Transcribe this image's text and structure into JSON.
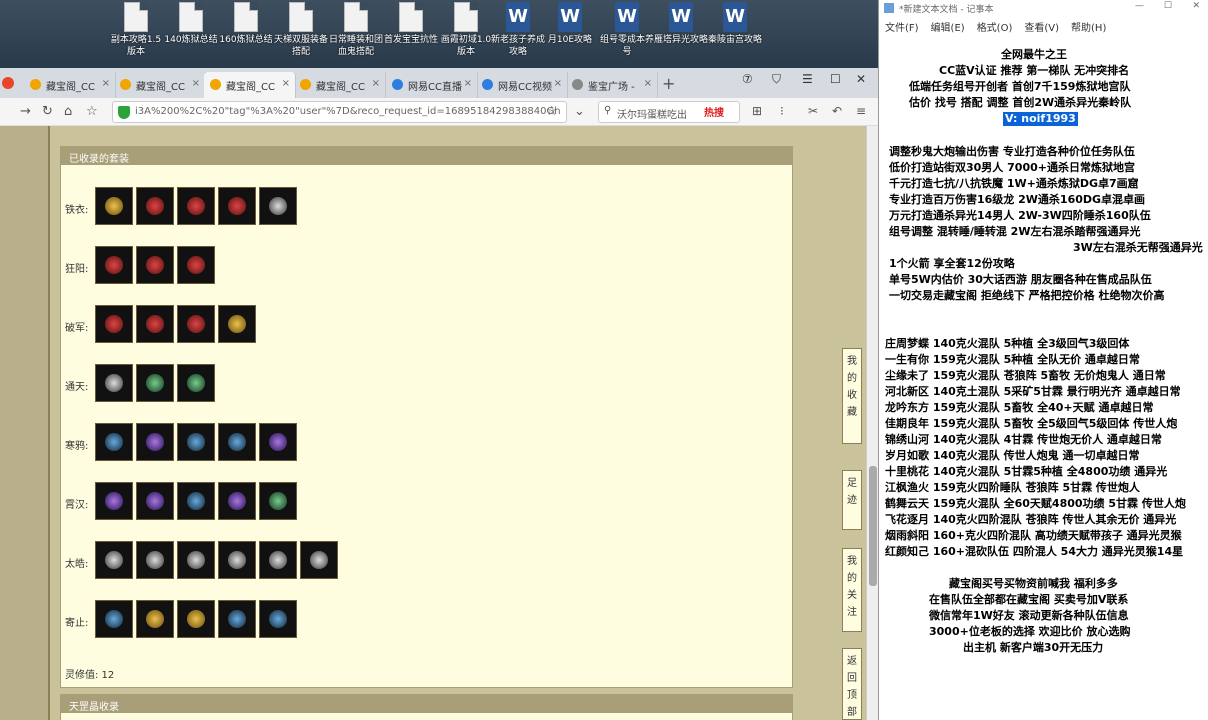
{
  "desktop": {
    "icons": [
      {
        "label": "副本攻略1.5版本",
        "type": "file"
      },
      {
        "label": "140炼狱总结",
        "type": "file"
      },
      {
        "label": "160炼狱总结",
        "type": "file"
      },
      {
        "label": "天梯双服装备搭配",
        "type": "file"
      },
      {
        "label": "日常睡装和团血鬼搭配",
        "type": "file"
      },
      {
        "label": "首发宝宝抗性",
        "type": "file"
      },
      {
        "label": "画霞初域1.0版本",
        "type": "file"
      },
      {
        "label": "新老孩子养成攻略",
        "type": "word"
      },
      {
        "label": "月10E攻略",
        "type": "word"
      },
      {
        "label": "组号零成本养号",
        "type": "word"
      },
      {
        "label": "雁塔异光攻略",
        "type": "word"
      },
      {
        "label": "秦陵宙宫攻略",
        "type": "word"
      }
    ]
  },
  "browser": {
    "tabs": [
      {
        "label": "藏宝阁_CC",
        "active": false
      },
      {
        "label": "藏宝阁_CC",
        "active": false
      },
      {
        "label": "藏宝阁_CC",
        "active": true
      },
      {
        "label": "藏宝阁_CC",
        "active": false
      },
      {
        "label": "网易CC直播",
        "active": false
      },
      {
        "label": "网易CC视频",
        "active": false
      },
      {
        "label": "鉴宝广场 -",
        "active": false
      }
    ],
    "url": "i3A%200%2C%20\"tag\"%3A%20\"user\"%7D&reco_request_id=1689518429838840Gh",
    "search_text": "沃尔玛蛋糕吃出",
    "hot_label": "热搜"
  },
  "page": {
    "section_title": "已收录的套装",
    "rows": [
      {
        "label": "铁衣:",
        "items": [
          "c-gold",
          "c-red",
          "c-red",
          "c-red",
          "c-silver"
        ]
      },
      {
        "label": "狂阳:",
        "items": [
          "c-red",
          "c-red",
          "c-red"
        ]
      },
      {
        "label": "破军:",
        "items": [
          "c-red",
          "c-red",
          "c-red",
          "c-gold"
        ]
      },
      {
        "label": "通天:",
        "items": [
          "c-silver",
          "c-green",
          "c-green"
        ]
      },
      {
        "label": "寒鸦:",
        "items": [
          "c-blue",
          "c-purple",
          "c-blue",
          "c-blue",
          "c-purple"
        ]
      },
      {
        "label": "霄汉:",
        "items": [
          "c-purple",
          "c-purple",
          "c-blue",
          "c-purple",
          "c-green"
        ]
      },
      {
        "label": "太皓:",
        "items": [
          "c-silver",
          "c-silver",
          "c-silver",
          "c-silver",
          "c-silver",
          "c-silver"
        ]
      },
      {
        "label": "寄止:",
        "items": [
          "c-blue",
          "c-gold",
          "c-gold",
          "c-blue",
          "c-blue"
        ]
      }
    ],
    "stat_text": "灵修值:  12",
    "next_section_title": "天罡晶收录",
    "side_nav": [
      "我的收藏",
      "足迹",
      "我的关注",
      "返回顶部"
    ]
  },
  "notepad": {
    "title": "*新建文本文档 - 记事本",
    "menu": [
      "文件(F)",
      "编辑(E)",
      "格式(O)",
      "查看(V)",
      "帮助(H)"
    ],
    "lines": [
      "全网最牛之王",
      "CC蓝V认证 推荐 第一梯队 无冲突排名",
      "低端任务组号开创者          首创7千159炼狱地宫队",
      "估价 找号 搭配 调整         首创2W通杀异光秦岭队",
      "V:  noif1993",
      "调整秒鬼大炮输出伤害          专业打造各种价位任务队伍",
      "低价打造站街双30男人           7000+通杀日常炼狱地宫",
      "千元打造七抗/八抗铁魔            1W+通杀炼狱DG卓7画窟",
      "专业打造百万伤害16级龙          2W通杀160DG卓混卓画",
      "万元打造通杀异光14男人          2W-3W四阶睡杀160队伍",
      "组号调整 混转睡/睡转混             2W左右混杀踏帮强通异光",
      "3W左右混杀无帮强通异光",
      "1个火箭 享全套12份攻略",
      "单号5W内估价 30大话西游         朋友圈各种在售成品队伍",
      "一切交易走藏宝阁 拒绝线下      严格把控价格 杜绝物次价高",
      "庄周梦蝶 140克火混队 5种植 全3级回气3级回体",
      "一生有你 159克火混队 5种植 全队无价 通卓越日常",
      "尘缘未了 159克火混队 苍狼阵 5畜牧 无价炮鬼人 通日常",
      "河北新区 140克土混队 5采矿5甘霖 景行明光齐 通卓越日常",
      "龙吟东方 159克火混队 5畜牧 全40+天赋 通卓越日常",
      "佳期良年 159克火混队 5畜牧 全5级回气5级回体 传世人炮",
      "锦绣山河 140克火混队 4甘霖 传世炮无价人 通卓越日常",
      "岁月如歌 140克火混队 传世人炮鬼 通一切卓越日常",
      "十里桃花 140克火混队 5甘霖5种植 全4800功绩 通异光",
      "江枫渔火 159克火四阶睡队 苍狼阵 5甘霖 传世炮人",
      "鹤舞云天 159克火混队 全60天赋4800功绩 5甘霖 传世人炮",
      "飞花逐月 140克火四阶混队 苍狼阵 传世人其余无价 通异光",
      "烟雨斜阳 160+克火四阶混队 高功绩天赋带孩子 通异光灵猴",
      "红颜知己 160+混砍队伍 四阶混人 54大力 通异光灵猴14星",
      "藏宝阁买号买物资前喊我 福利多多",
      "在售队伍全部都在藏宝阁 买卖号加V联系",
      "微信常年1W好友 滚动更新各种队伍信息",
      "3000+位老板的选择 欢迎比价 放心选购",
      "出主机 新客户端30开无压力"
    ]
  }
}
